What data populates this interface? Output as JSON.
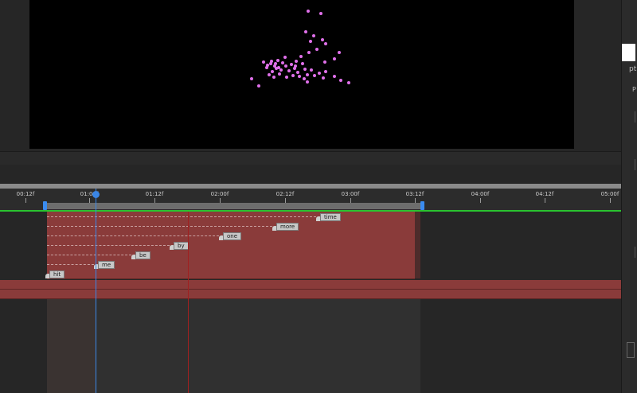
{
  "side_panel": {
    "unit_label": "pt",
    "field_label": "P"
  },
  "ruler": {
    "labels": [
      "00:12f",
      "01:00f",
      "01:12f",
      "02:00f",
      "02:12f",
      "03:00f",
      "03:12f",
      "04:00f",
      "04:12f",
      "05:00f"
    ]
  },
  "markers": [
    "time",
    "more",
    "one",
    "by",
    "be",
    "me",
    "hit"
  ],
  "colors": {
    "particle": "#e070ea",
    "layer": "#8a3b3a",
    "playhead": "#3a86e6",
    "work_area_bar": "#29c22f"
  }
}
